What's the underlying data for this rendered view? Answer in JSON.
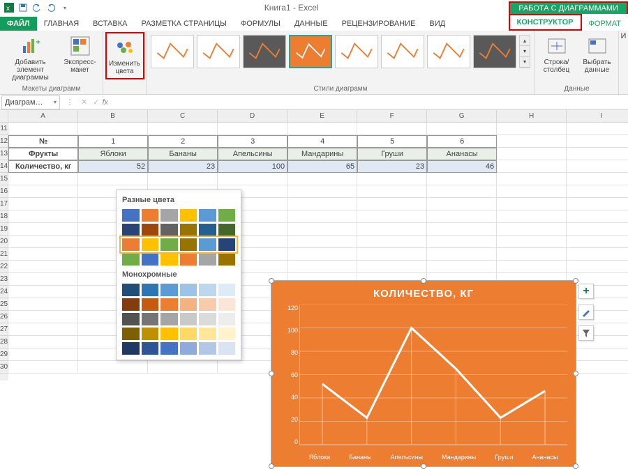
{
  "app": {
    "title": "Книга1 - Excel",
    "context_title": "РАБОТА С ДИАГРАММАМИ"
  },
  "qat": {
    "save": "save-icon",
    "undo": "undo-icon",
    "redo": "redo-icon"
  },
  "tabs": {
    "file": "ФАЙЛ",
    "list": [
      "ГЛАВНАЯ",
      "ВСТАВКА",
      "РАЗМЕТКА СТРАНИЦЫ",
      "ФОРМУЛЫ",
      "ДАННЫЕ",
      "РЕЦЕНЗИРОВАНИЕ",
      "ВИД"
    ],
    "context": [
      "КОНСТРУКТОР",
      "ФОРМАТ"
    ],
    "active_context": "КОНСТРУКТОР"
  },
  "ribbon": {
    "layouts": {
      "add_element": "Добавить элемент диаграммы",
      "express": "Экспресс-макет",
      "label": "Макеты диаграмм"
    },
    "change_colors": "Изменить цвета",
    "styles_label": "Стили диаграмм",
    "data": {
      "switch": "Строка/столбец",
      "select": "Выбрать данные",
      "label": "Данные"
    },
    "more": "И"
  },
  "namebox": "Диаграм…",
  "fx_symbol": "fx",
  "columns": [
    "A",
    "B",
    "C",
    "D",
    "E",
    "F",
    "G",
    "H",
    "I"
  ],
  "rows_start": 11,
  "rows_end": 30,
  "table": {
    "r12": {
      "A": "№",
      "B": "1",
      "C": "2",
      "D": "3",
      "E": "4",
      "F": "5",
      "G": "6"
    },
    "r13": {
      "A": "Фрукты",
      "B": "Яблоки",
      "C": "Бананы",
      "D": "Апельсины",
      "E": "Мандарины",
      "F": "Груши",
      "G": "Ананасы"
    },
    "r14": {
      "A": "Количество, кг",
      "B": "52",
      "C": "23",
      "D": "100",
      "E": "65",
      "F": "23",
      "G": "46"
    }
  },
  "palette": {
    "section1": "Разные цвета",
    "section2": "Монохромные",
    "colors1": [
      [
        "#4472c4",
        "#ed7d31",
        "#a5a5a5",
        "#ffc000",
        "#5b9bd5",
        "#70ad47"
      ],
      [
        "#264478",
        "#9e480e",
        "#636363",
        "#997300",
        "#255e91",
        "#43682b"
      ],
      [
        "#ed7d31",
        "#ffc000",
        "#70ad47",
        "#997300",
        "#5b9bd5",
        "#264478"
      ],
      [
        "#70ad47",
        "#4472c4",
        "#ffc000",
        "#ed7d31",
        "#a5a5a5",
        "#997300"
      ]
    ],
    "colors2": [
      [
        "#1f4e79",
        "#2e75b6",
        "#5b9bd5",
        "#9dc3e6",
        "#bdd7ee",
        "#deebf7"
      ],
      [
        "#843c0c",
        "#c55a11",
        "#ed7d31",
        "#f4b183",
        "#f8cbad",
        "#fbe5d6"
      ],
      [
        "#525252",
        "#757575",
        "#a5a5a5",
        "#c9c9c9",
        "#dbdbdb",
        "#ededed"
      ],
      [
        "#7f6000",
        "#bf9000",
        "#ffc000",
        "#ffd966",
        "#ffe699",
        "#fff2cc"
      ],
      [
        "#1f3864",
        "#2f5597",
        "#4472c4",
        "#8faadc",
        "#b4c7e7",
        "#dae3f3"
      ]
    ],
    "selected_row": 2
  },
  "chart_data": {
    "type": "line",
    "title": "КОЛИЧЕСТВО, КГ",
    "categories": [
      "Яблоки",
      "Бананы",
      "Апельсины",
      "Мандарины",
      "Груши",
      "Ананасы"
    ],
    "values": [
      52,
      23,
      100,
      65,
      23,
      46
    ],
    "ylim": [
      0,
      120
    ],
    "yticks": [
      0,
      20,
      40,
      60,
      80,
      100,
      120
    ],
    "background": "#ed7d31",
    "line_color": "#ffffff"
  },
  "side_buttons": {
    "plus": "+",
    "brush": "brush-icon",
    "filter": "filter-icon"
  }
}
